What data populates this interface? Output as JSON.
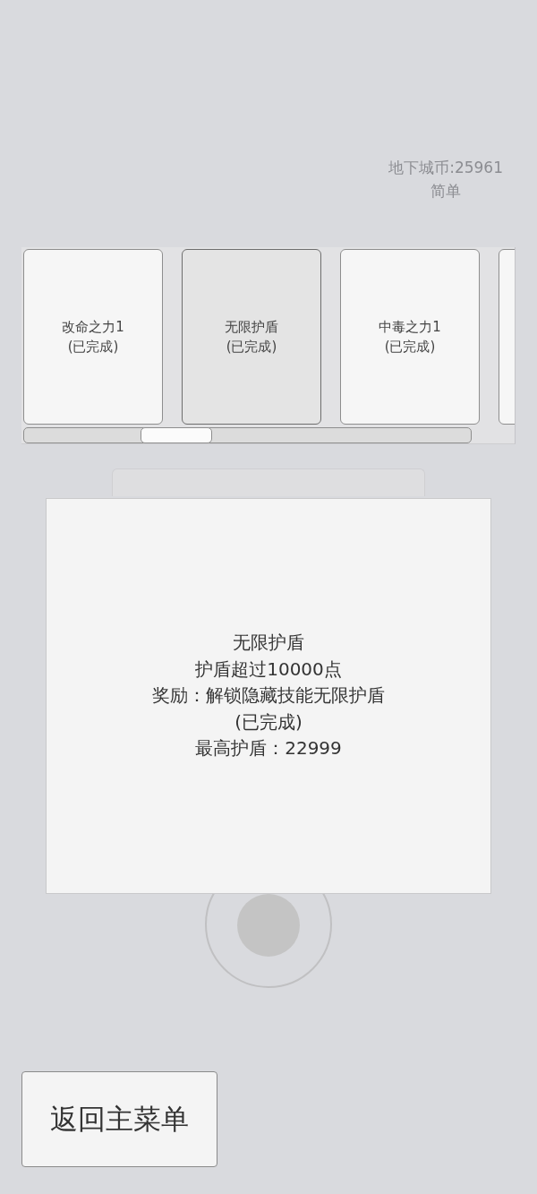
{
  "currency": {
    "label": "地下城币:25961"
  },
  "difficulty": {
    "label": "简单"
  },
  "achievements": [
    {
      "title": "改命之力1",
      "status": "(已完成)",
      "selected": false
    },
    {
      "title": "无限护盾",
      "status": "(已完成)",
      "selected": true
    },
    {
      "title": "中毒之力1",
      "status": "(已完成)",
      "selected": false
    }
  ],
  "detail_popup": {
    "title": "无限护盾",
    "requirement": "护盾超过10000点",
    "reward": "奖励：解锁隐藏技能无限护盾",
    "status": "(已完成)",
    "record": "最高护盾：22999"
  },
  "back_button": {
    "label": "返回主菜单"
  }
}
